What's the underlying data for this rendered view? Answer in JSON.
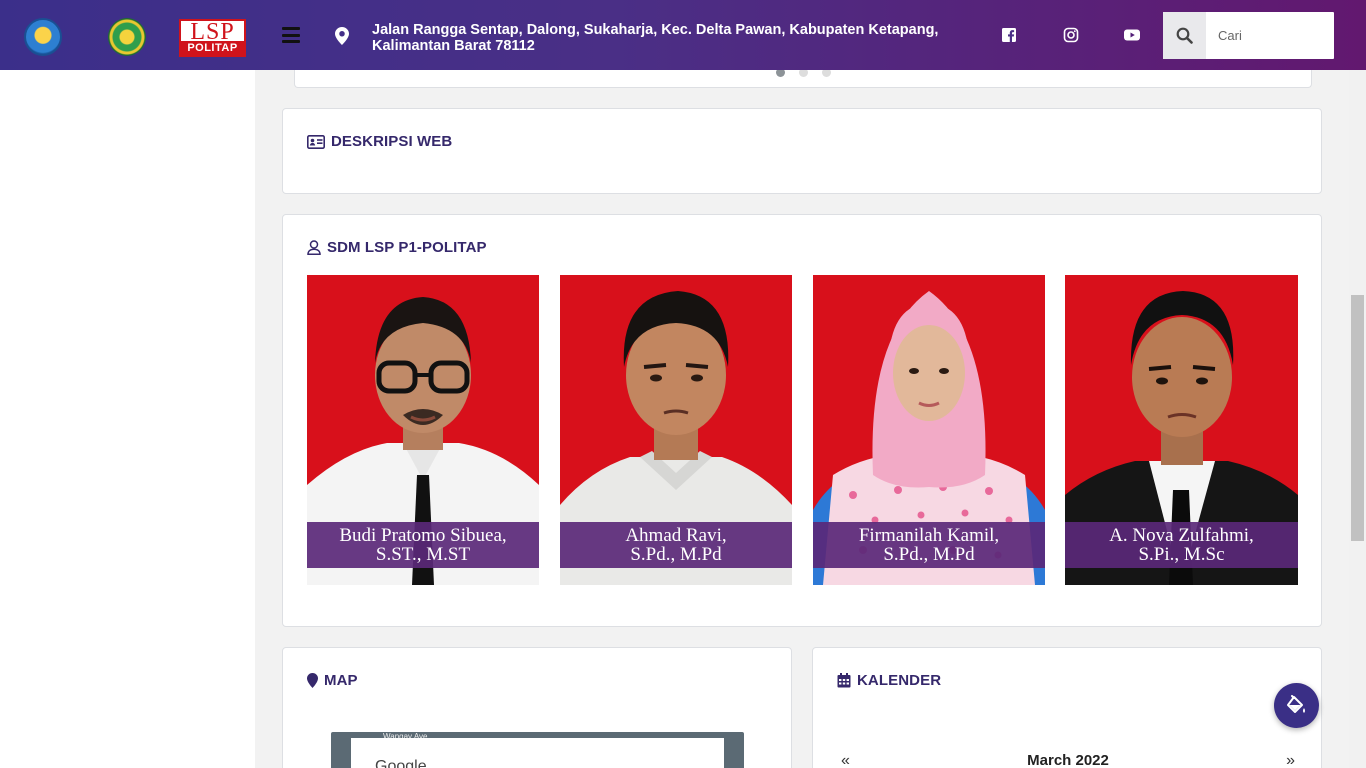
{
  "header": {
    "logos": [
      {
        "name": "tut-wuri-handayani-logo"
      },
      {
        "name": "politap-logo"
      },
      {
        "name": "lsp-politap-logo",
        "top_text": "LSP",
        "bottom_text": "POLITAP"
      }
    ],
    "menu_icon": "hamburger-icon",
    "location_icon": "map-marker-icon",
    "address_line1": "Jalan Rangga Sentap, Dalong, Sukaharja, Kec. Delta Pawan, Kabupaten Ketapang,",
    "address_line2": "Kalimantan Barat 78112",
    "social": [
      "facebook-icon",
      "instagram-icon",
      "youtube-icon"
    ],
    "search": {
      "placeholder": "Cari",
      "value": ""
    },
    "gradient_start": "#3b2f8a",
    "gradient_end": "#62186f"
  },
  "slider": {
    "dots": 3,
    "active": 0
  },
  "deskripsi": {
    "title": "DESKRIPSI WEB"
  },
  "sdm": {
    "title": "SDM LSP P1-POLITAP",
    "people": [
      {
        "name": "Budi Pratomo Sibuea,",
        "degree": "S.ST., M.ST",
        "background": "#d8101b",
        "attire": "white-shirt-black-tie",
        "glasses": true
      },
      {
        "name": "Ahmad Ravi,",
        "degree": "S.Pd., M.Pd",
        "background": "#d8101b",
        "attire": "light-grey-shirt",
        "glasses": false
      },
      {
        "name": "Firmanilah Kamil,",
        "degree": "S.Pd., M.Pd",
        "background": "#d8101b",
        "attire": "pink-hijab-floral",
        "glasses": false
      },
      {
        "name": "A. Nova Zulfahmi,",
        "degree": "S.Pi., M.Sc",
        "background": "#d8101b",
        "attire": "black-suit",
        "glasses": false
      }
    ]
  },
  "map": {
    "title": "MAP",
    "provider_text": "Google",
    "street_label": "Wangay Ave"
  },
  "kalender": {
    "title": "KALENDER",
    "month": "March 2022",
    "prev": "«",
    "next": "»"
  },
  "accent": "#35286b"
}
